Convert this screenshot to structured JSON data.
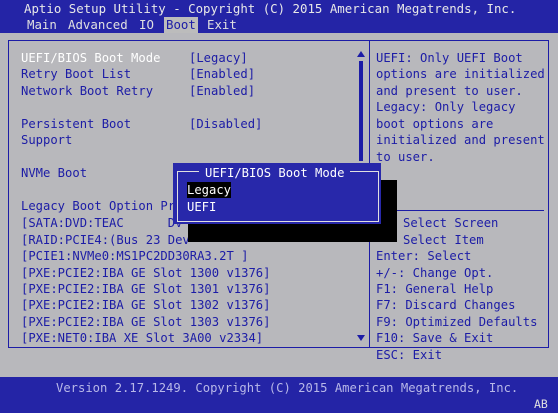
{
  "header": {
    "title": "Aptio Setup Utility - Copyright (C) 2015 American Megatrends, Inc.",
    "tabs": [
      "Main",
      "Advanced",
      "IO",
      "Boot",
      "Exit"
    ],
    "active_tab": "Boot"
  },
  "settings": [
    {
      "label": "UEFI/BIOS Boot Mode",
      "value": "[Legacy]"
    },
    {
      "label": "Retry Boot List",
      "value": "[Enabled]"
    },
    {
      "label": "Network Boot Retry",
      "value": "[Enabled]"
    },
    {
      "label": "Persistent Boot",
      "label2": "Support",
      "value": "[Disabled]"
    },
    {
      "label": "NVMe Boot",
      "value": ""
    }
  ],
  "legacy_section": {
    "title": "Legacy Boot Option Pri",
    "options": [
      "[SATA:DVD:TEAC      DV-W",
      "[RAID:PCIE4:(Bus 23 Dev",
      "[PCIE1:NVMe0:MS1PC2DD30RA3.2T ]",
      "[PXE:PCIE2:IBA GE Slot 1300 v1376]",
      "[PXE:PCIE2:IBA GE Slot 1301 v1376]",
      "[PXE:PCIE2:IBA GE Slot 1302 v1376]",
      "[PXE:PCIE2:IBA GE Slot 1303 v1376]",
      "[PXE:NET0:IBA XE Slot 3A00 v2334]"
    ]
  },
  "help": [
    "UEFI: Only UEFI Boot",
    "options are initialized",
    "and present to user.",
    "Legacy: Only legacy",
    "boot options are",
    "initialized and present",
    "to user."
  ],
  "keys": [
    "Select Screen",
    "Select Item",
    "Enter: Select",
    "+/-: Change Opt.",
    "F1: General Help",
    "F7: Discard Changes",
    "F9: Optimized Defaults",
    "F10: Save & Exit",
    "ESC: Exit"
  ],
  "popup": {
    "title": "UEFI/BIOS Boot Mode",
    "options": [
      "Legacy",
      "UEFI"
    ],
    "selected": "Legacy"
  },
  "footer": {
    "version": "Version 2.17.1249. Copyright (C) 2015 American Megatrends, Inc.",
    "badge": "AB"
  },
  "colors": {
    "bar": "#2424a6",
    "panel_bg": "#b8b8bc",
    "text": "#1c1ca6",
    "highlight": "#ffffff",
    "popup_bg": "#2828aa"
  }
}
